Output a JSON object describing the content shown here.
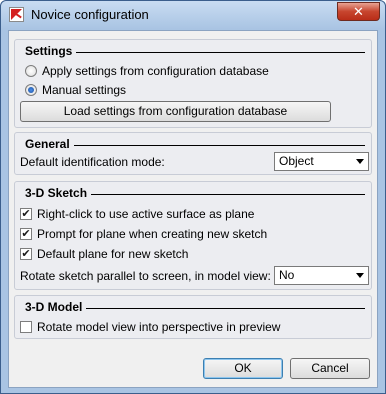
{
  "window": {
    "title": "Novice configuration",
    "close_glyph": "✕"
  },
  "settings": {
    "title": "Settings",
    "radio_apply": "Apply settings from configuration database",
    "radio_manual": "Manual settings",
    "selected": "manual",
    "load_button": "Load settings from configuration database"
  },
  "general": {
    "title": "General",
    "identification_label": "Default identification mode:",
    "identification_value": "Object"
  },
  "sketch": {
    "title": "3-D Sketch",
    "check_rightclick": "Right-click to use active surface as plane",
    "check_prompt": "Prompt for plane when creating new sketch",
    "check_default_plane": "Default plane for new sketch",
    "rotate_label": "Rotate sketch parallel to screen, in model view:",
    "rotate_value": "No",
    "checked": {
      "rightclick": true,
      "prompt": true,
      "default_plane": true
    }
  },
  "model": {
    "title": "3-D Model",
    "check_perspective": "Rotate model view into perspective in preview",
    "checked": {
      "perspective": false
    }
  },
  "buttons": {
    "ok": "OK",
    "cancel": "Cancel"
  },
  "icons": {
    "app": "app-logo-icon",
    "close": "close-icon",
    "dropdown": "chevron-down-icon",
    "checkmark": "checkmark-icon"
  },
  "check_glyph": "✔"
}
